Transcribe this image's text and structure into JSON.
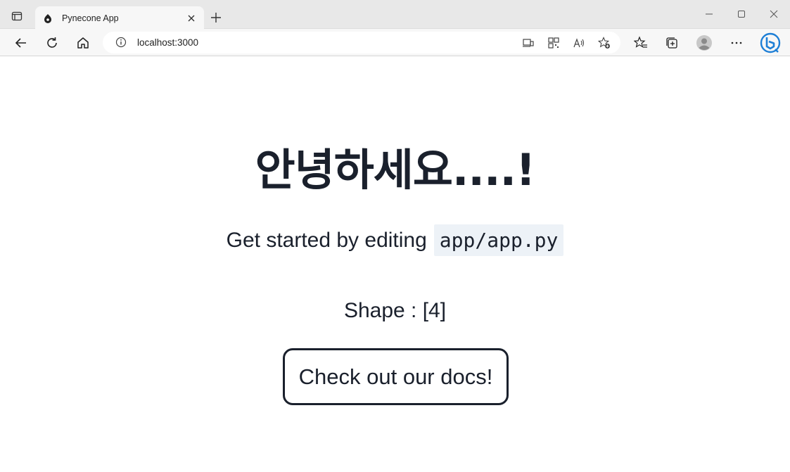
{
  "browser": {
    "tab": {
      "title": "Pynecone App"
    },
    "address_bar": {
      "url": "localhost:3000"
    }
  },
  "page": {
    "heading": "안녕하세요....!",
    "subtitle_text": "Get started by editing",
    "subtitle_code": "app/app.py",
    "shape_text": "Shape : [4]",
    "docs_button": "Check out our docs!"
  }
}
